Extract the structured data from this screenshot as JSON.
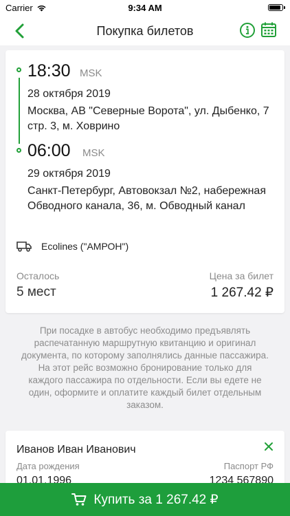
{
  "status_bar": {
    "carrier": "Carrier",
    "time": "9:34 AM"
  },
  "nav": {
    "title": "Покупка билетов",
    "icons": [
      "back-arrow-icon",
      "info-icon",
      "calendar-icon"
    ]
  },
  "trip": {
    "departure": {
      "time": "18:30",
      "tz": "MSK",
      "date": "28 октября 2019",
      "address": "Москва, АВ \"Северные Ворота\", ул. Дыбенко, 7 стр. 3, м. Ховрино"
    },
    "arrival": {
      "time": "06:00",
      "tz": "MSK",
      "date": "29 октября 2019",
      "address": "Санкт-Петербург, Автовокзал №2, набережная Обводного канала, 36, м. Обводный канал"
    },
    "carrier": "Ecolines (\"АМРОН\")",
    "remain_label": "Осталось",
    "remain_value": "5 мест",
    "price_label": "Цена за билет",
    "price_value": "1 267.42 ₽"
  },
  "notice": {
    "line1": "При посадке в автобус необходимо предъявлять распечатанную маршрутную квитанцию и оригинал документа, по которому заполнялись данные пассажира.",
    "line2": "На этот рейс возможно бронирование только для каждого пассажира по отдельности. Если вы едете не один, оформите и оплатите каждый билет отдельным заказом."
  },
  "passenger": {
    "name": "Иванов Иван Иванович",
    "dob_label": "Дата рождения",
    "doc_label": "Паспорт РФ",
    "dob_value": "01.01.1996",
    "doc_value": "1234 567890"
  },
  "buy_button": {
    "label": "Купить за 1 267.42 ₽"
  },
  "colors": {
    "accent": "#21a038",
    "button": "#1e9e3c",
    "background": "#f2f2f4"
  }
}
